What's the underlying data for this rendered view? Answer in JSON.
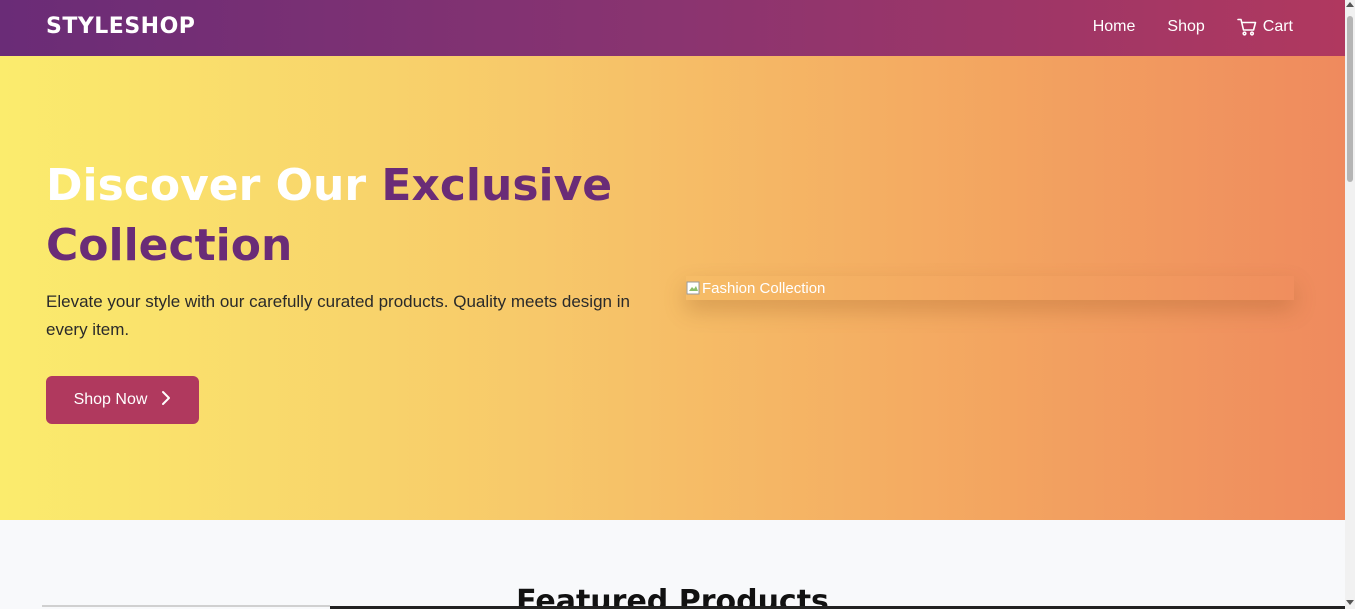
{
  "navbar": {
    "brand": "STYLESHOP",
    "links": [
      {
        "label": "Home"
      },
      {
        "label": "Shop"
      },
      {
        "label": "Cart",
        "icon": "cart-icon"
      }
    ]
  },
  "hero": {
    "title_part1": "Discover Our ",
    "title_accent": "Exclusive Collection",
    "subtitle": "Elevate your style with our carefully curated products. Quality meets design in every item.",
    "cta_label": "Shop Now",
    "cta_icon": "chevron-right-icon",
    "image_alt": "Fashion Collection"
  },
  "featured": {
    "title": "Featured Products"
  },
  "colors": {
    "brand_purple": "#6a2c77",
    "accent_pink": "#b0395e",
    "hero_gradient_start": "#fbec6d",
    "hero_gradient_end": "#ef8a5e"
  }
}
